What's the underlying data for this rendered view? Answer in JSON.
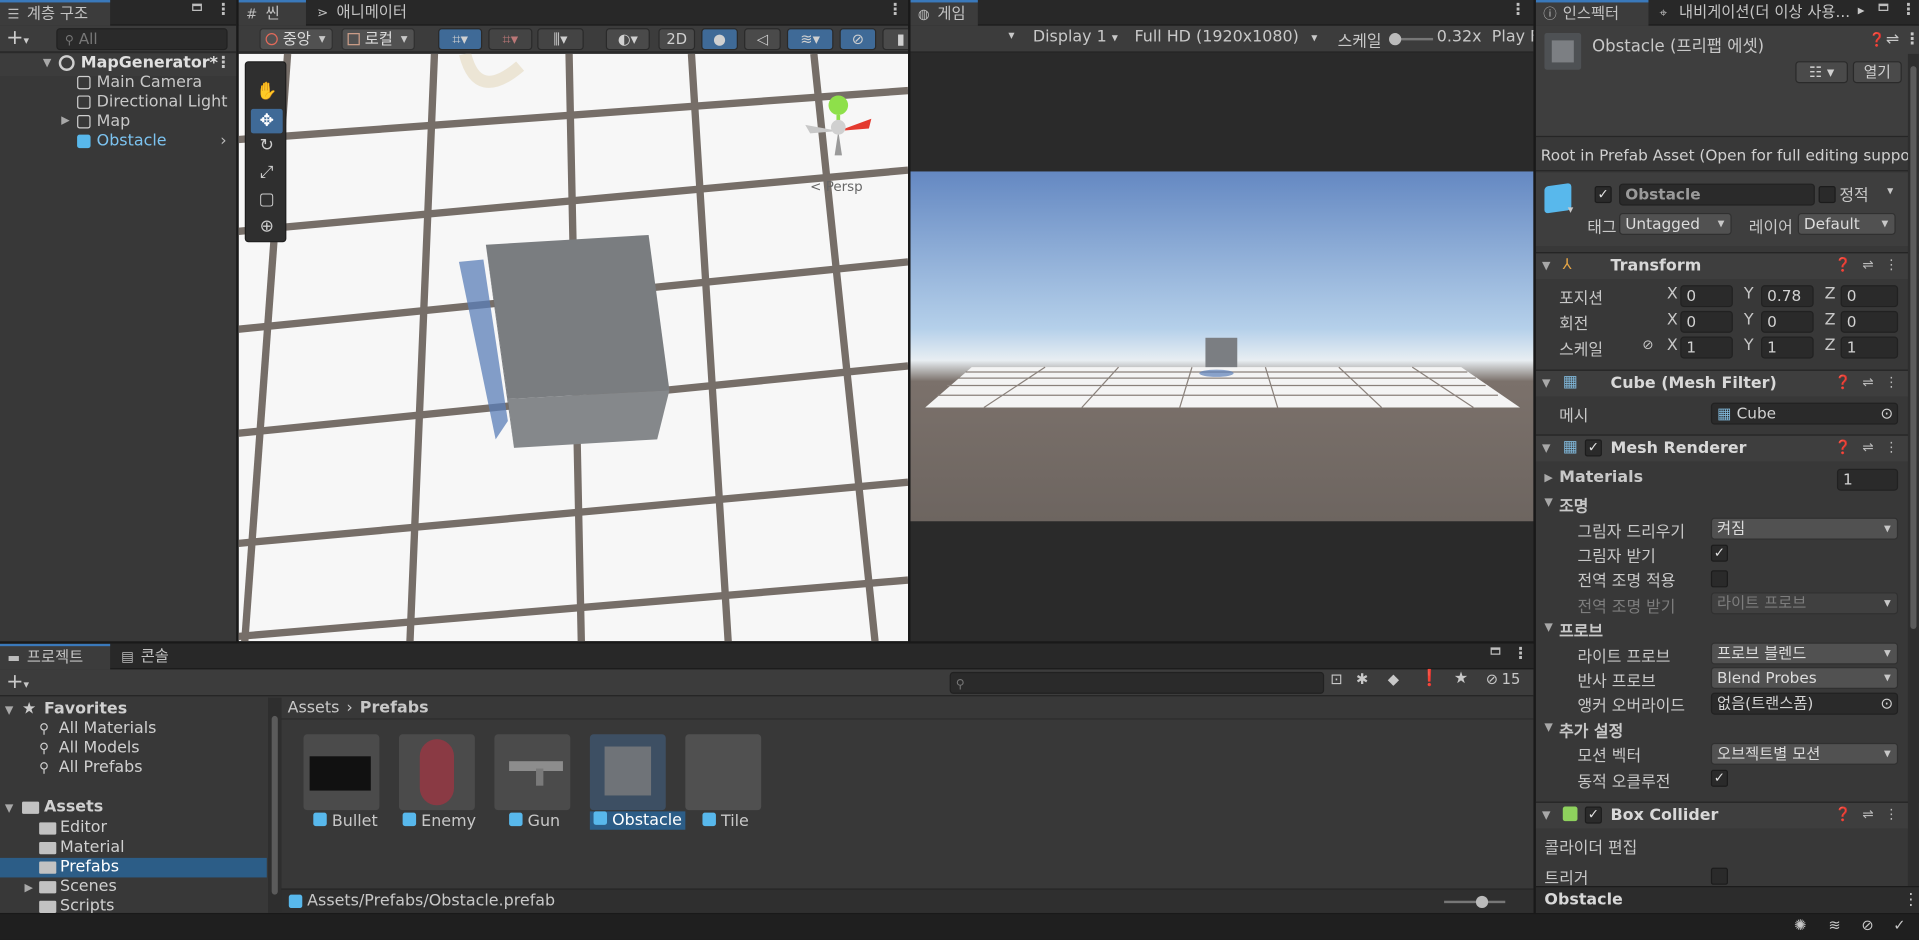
{
  "colors": {
    "accent": "#3a79bb",
    "selection": "#2c5d87",
    "prefab_blue": "#58b8ec"
  },
  "hierarchy": {
    "tab": "계층 구조",
    "search_placeholder": "All",
    "scene": "MapGenerator*",
    "items": [
      "Main Camera",
      "Directional Light",
      "Map",
      "Obstacle"
    ]
  },
  "scene": {
    "tab": "씬",
    "anim_tab": "애니메이터",
    "pivot": "중앙",
    "space": "로컬",
    "mode_2d": "2D",
    "persp": "< Persp"
  },
  "game": {
    "tab": "게임",
    "display": "Display 1",
    "resolution": "Full HD (1920x1080)",
    "scale_label": "스케일",
    "scale_value": "0.32x",
    "play": "Play F"
  },
  "inspector": {
    "tab": "인스펙터",
    "nav_tab": "내비게이션(더 이상 사용...",
    "title": "Obstacle (프리팹 에셋)",
    "open_button": "열기",
    "root_msg": "Root in Prefab Asset (Open for full editing suppo",
    "name": "Obstacle",
    "static_label": "정적",
    "tag_label": "태그",
    "tag_value": "Untagged",
    "layer_label": "레이어",
    "layer_value": "Default",
    "transform": {
      "title": "Transform",
      "pos_label": "포지션",
      "rot_label": "회전",
      "scale_label": "스케일",
      "pos": {
        "x": "0",
        "y": "0.78",
        "z": "0"
      },
      "rot": {
        "x": "0",
        "y": "0",
        "z": "0"
      },
      "scale": {
        "x": "1",
        "y": "1",
        "z": "1"
      }
    },
    "mesh_filter": {
      "title": "Cube (Mesh Filter)",
      "mesh_label": "메시",
      "mesh_value": "Cube"
    },
    "mesh_renderer": {
      "title": "Mesh Renderer",
      "materials_label": "Materials",
      "materials_count": "1",
      "lighting_label": "조명",
      "cast_shadows_label": "그림자 드리우기",
      "cast_shadows_value": "켜짐",
      "receive_shadows_label": "그림자 받기",
      "contribute_gi_label": "전역 조명 적용",
      "receive_gi_label": "전역 조명 받기",
      "receive_gi_value": "라이트 프로브",
      "probes_label": "프로브",
      "light_probes_label": "라이트 프로브",
      "light_probes_value": "프로브 블렌드",
      "reflection_probes_label": "반사 프로브",
      "reflection_probes_value": "Blend Probes",
      "anchor_label": "앵커 오버라이드",
      "anchor_value": "없음(트랜스폼)",
      "additional_label": "추가 설정",
      "motion_label": "모션 벡터",
      "motion_value": "오브젝트별 모션",
      "occlusion_label": "동적 오클루전"
    },
    "box_collider": {
      "title": "Box Collider",
      "edit_label": "콜라이더 편집",
      "trigger_label": "트리거"
    },
    "footer": "Obstacle"
  },
  "project": {
    "tab": "프로젝트",
    "console_tab": "콘솔",
    "hidden_count": "15",
    "favorites": "Favorites",
    "fav_items": [
      "All Materials",
      "All Models",
      "All Prefabs"
    ],
    "assets": "Assets",
    "folders": [
      "Editor",
      "Material",
      "Prefabs",
      "Scenes",
      "Scripts"
    ],
    "breadcrumb_root": "Assets",
    "breadcrumb_current": "Prefabs",
    "items": [
      "Bullet",
      "Enemy",
      "Gun",
      "Obstacle",
      "Tile"
    ],
    "path": "Assets/Prefabs/Obstacle.prefab"
  }
}
